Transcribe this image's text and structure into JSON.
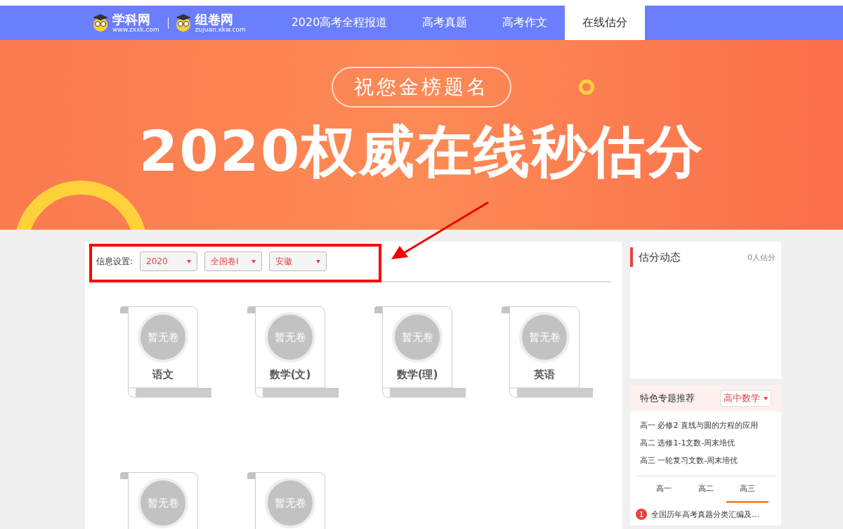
{
  "nav": {
    "logos": [
      {
        "name": "学科网",
        "url": "www.zxxk.com"
      },
      {
        "name": "组卷网",
        "url": "zujuan.xkw.com"
      }
    ],
    "items": [
      {
        "label": "2020高考全程报道",
        "selected": false
      },
      {
        "label": "高考真题",
        "selected": false
      },
      {
        "label": "高考作文",
        "selected": false
      },
      {
        "label": "在线估分",
        "selected": true
      }
    ]
  },
  "banner": {
    "badge": "祝您金榜题名",
    "headline": "2020权威在线秒估分"
  },
  "settings": {
    "label": "信息设置:",
    "selects": [
      "2020",
      "全国卷I",
      "安徽"
    ]
  },
  "papers": [
    {
      "status": "暂无卷",
      "subject": "语文"
    },
    {
      "status": "暂无卷",
      "subject": "数学(文)"
    },
    {
      "status": "暂无卷",
      "subject": "数学(理)"
    },
    {
      "status": "暂无卷",
      "subject": "英语"
    },
    {
      "status": "暂无卷"
    },
    {
      "status": "暂无卷"
    }
  ],
  "estimates": {
    "title": "估分动态",
    "count": "0人估分"
  },
  "featured": {
    "title": "特色专题推荐",
    "select": "高中数学",
    "links": [
      "高一 必修2 直线与圆的方程的应用",
      "高二 选修1-1文数-周末培优",
      "高三 一轮复习文数-周末培优"
    ],
    "tabs": [
      {
        "label": "高一",
        "selected": false
      },
      {
        "label": "高二",
        "selected": false
      },
      {
        "label": "高三",
        "selected": true
      }
    ],
    "list": [
      {
        "rank": "1",
        "title": "全国历年高考真题分类汇编及…"
      }
    ]
  }
}
